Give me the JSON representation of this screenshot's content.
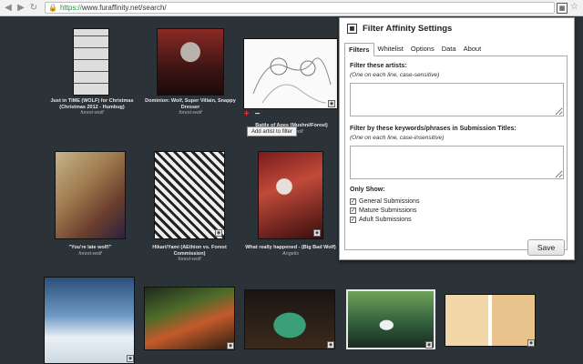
{
  "browser": {
    "url_scheme": "https://",
    "url_rest": "www.furaffinity.net/search/",
    "nav_icons": [
      "back-icon",
      "forward-icon",
      "reload-icon"
    ]
  },
  "gallery": [
    {
      "title": "Just in TIME (WOLF) for Christmas (Christmas 2012 - Humbug)",
      "artist": "forest-wolf"
    },
    {
      "title": "Dominion: Wolf, Super Villain, Snappy Dresser",
      "artist": "forest-wolf"
    },
    {
      "title": "Battle of Ages (Mushni/Forest)",
      "artist": "forest-wolf"
    },
    {
      "title": "\"You're late wolf!\"",
      "artist": "forest-wolf"
    },
    {
      "title": "Hikari/Yami (AEthion vs. Forest Commission)",
      "artist": "forest-wolf"
    },
    {
      "title": "What really happened - (Big Bad Wolf)",
      "artist": "Angelis"
    }
  ],
  "hover_controls": {
    "add": "+",
    "remove": "−",
    "tooltip": "Add artist to filter"
  },
  "popup": {
    "title": "Filter Affinity Settings",
    "tabs": [
      "Filters",
      "Whitelist",
      "Options",
      "Data",
      "About"
    ],
    "active_tab": "Filters",
    "artists_label": "Filter these artists:",
    "artists_hint": "(One on each line, case-sensitive)",
    "artists_value": "",
    "keywords_label": "Filter by these keywords/phrases in Submission Titles:",
    "keywords_hint": "(One on each line, case-insensitive)",
    "keywords_value": "",
    "only_show_label": "Only Show:",
    "checkboxes": [
      {
        "label": "General Submissions",
        "checked": true
      },
      {
        "label": "Mature Submissions",
        "checked": true
      },
      {
        "label": "Adult Submissions",
        "checked": true
      }
    ],
    "save_label": "Save"
  },
  "colors": {
    "page_bg": "#2b3338",
    "accent_remove": "#e23b2e"
  }
}
